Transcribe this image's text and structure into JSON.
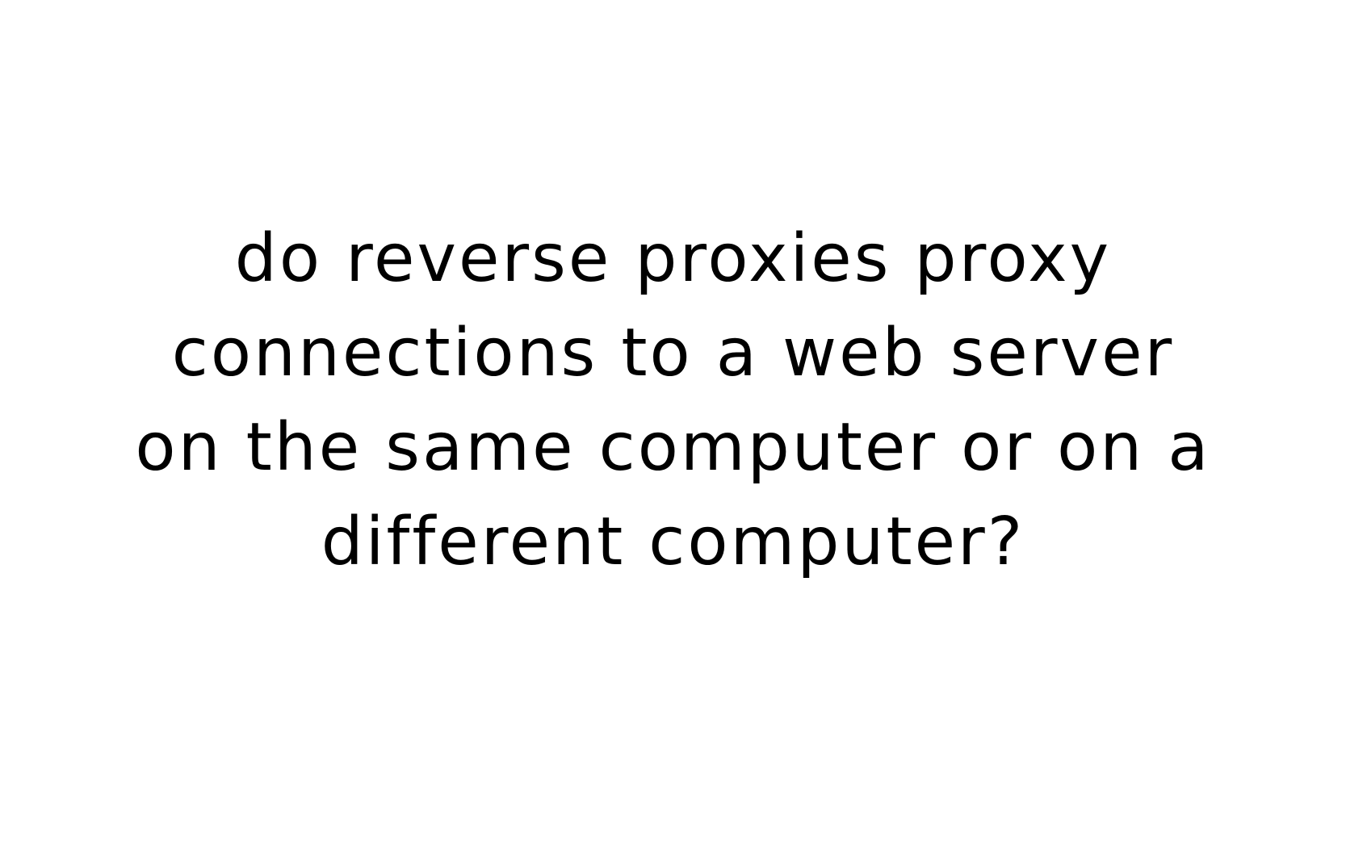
{
  "question": {
    "lines": [
      "do reverse proxies proxy",
      "connections to a web server",
      "on the same computer or on a",
      "different computer?"
    ]
  },
  "colors": {
    "background": "#ffffff",
    "text": "#000000"
  }
}
